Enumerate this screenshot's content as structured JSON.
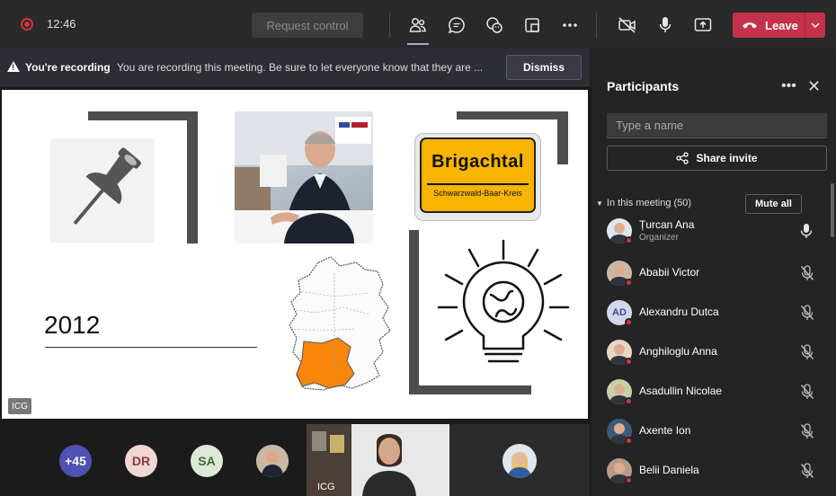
{
  "topbar": {
    "time": "12:46",
    "request_control_label": "Request control",
    "icons": [
      "people-icon",
      "chat-icon",
      "reactions-icon",
      "rooms-icon",
      "more-icon",
      "camera-off-icon",
      "mic-icon",
      "share-tray-icon"
    ],
    "leave_label": "Leave"
  },
  "banner": {
    "title": "You're recording",
    "text": "You are recording this meeting. Be sure to let everyone know that they are ...",
    "dismiss_label": "Dismiss"
  },
  "slide": {
    "year": "2012",
    "sign_title": "Brigachtal",
    "sign_subtitle": "Schwarzwald-Baar-Kreis",
    "icg_label": "ICG"
  },
  "bottom_strip": {
    "more_count": "+45",
    "avatar_initials": [
      "DR",
      "SA"
    ],
    "tile_label": "ICG"
  },
  "participants": {
    "title": "Participants",
    "search_placeholder": "Type a name",
    "share_invite_label": "Share invite",
    "in_meeting_label": "In this meeting (50)",
    "mute_all_label": "Mute all",
    "list": [
      {
        "name": "Țurcan Ana",
        "role": "Organizer",
        "initials": "",
        "mic": "on"
      },
      {
        "name": "Ababii Victor",
        "role": "",
        "initials": "",
        "mic": "muted"
      },
      {
        "name": "Alexandru Dutca",
        "role": "",
        "initials": "AD",
        "mic": "muted"
      },
      {
        "name": "Anghiloglu Anna",
        "role": "",
        "initials": "",
        "mic": "muted"
      },
      {
        "name": "Asadullin Nicolae",
        "role": "",
        "initials": "",
        "mic": "muted"
      },
      {
        "name": "Axente Ion",
        "role": "",
        "initials": "",
        "mic": "muted"
      },
      {
        "name": "Belii Daniela",
        "role": "",
        "initials": "",
        "mic": "muted"
      }
    ]
  },
  "colors": {
    "leave": "#c4314b",
    "recording": "#d13438",
    "sign_yellow": "#f7b500",
    "map_highlight": "#f7860b",
    "accent": "#a6a7dc"
  }
}
